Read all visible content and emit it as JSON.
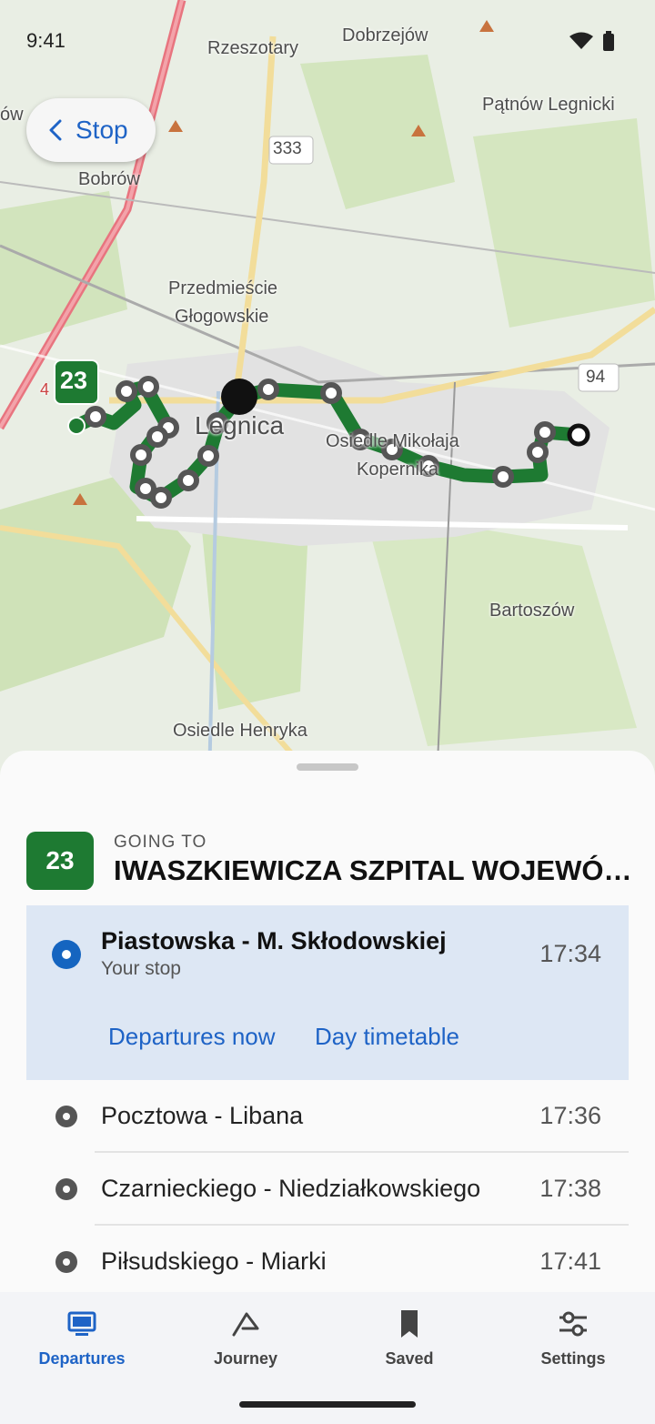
{
  "status_bar": {
    "time": "9:41"
  },
  "header": {
    "back_label": "Stop"
  },
  "map": {
    "place_labels": [
      "Rzeszotary",
      "Dobrzejów",
      "Pątnów Legnicki",
      "Bobrów",
      "Przedmieście",
      "Głogowskie",
      "Legnica",
      "Osiedle Mikołaja",
      "Kopernika",
      "Bartoszów",
      "Osiedle Henryka",
      "ów"
    ],
    "road_shields": [
      "333",
      "94",
      "4"
    ],
    "route_badge": "23",
    "route_color": "#1e7a32"
  },
  "route": {
    "number": "23",
    "going_to_label": "GOING TO",
    "destination": "IWASZKIEWICZA SZPITAL WOJEWÓDZKI"
  },
  "current_stop": {
    "name": "Piastowska - M. Skłodowskiej",
    "subtitle": "Your stop",
    "time": "17:34",
    "departures_now_label": "Departures now",
    "day_timetable_label": "Day timetable"
  },
  "stops": [
    {
      "name": "Pocztowa - Libana",
      "time": "17:36"
    },
    {
      "name": "Czarnieckiego - Niedziałkowskiego",
      "time": "17:38"
    },
    {
      "name": "Piłsudskiego - Miarki",
      "time": "17:41"
    }
  ],
  "nav": {
    "items": [
      {
        "label": "Departures",
        "icon": "monitor-icon"
      },
      {
        "label": "Journey",
        "icon": "route-arrow-icon"
      },
      {
        "label": "Saved",
        "icon": "bookmark-icon"
      },
      {
        "label": "Settings",
        "icon": "sliders-icon"
      }
    ],
    "active_color": "#1e63c6"
  }
}
